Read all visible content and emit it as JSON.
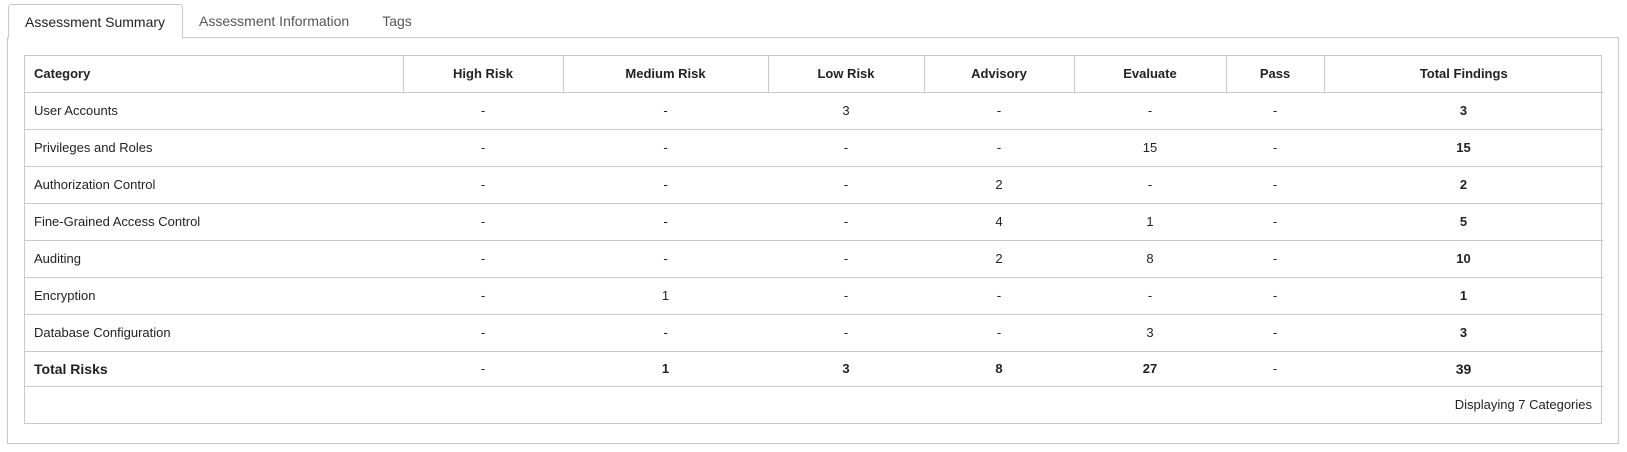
{
  "tabs": [
    {
      "label": "Assessment Summary",
      "active": true
    },
    {
      "label": "Assessment Information",
      "active": false
    },
    {
      "label": "Tags",
      "active": false
    }
  ],
  "table": {
    "headers": [
      "Category",
      "High Risk",
      "Medium Risk",
      "Low Risk",
      "Advisory",
      "Evaluate",
      "Pass",
      "Total Findings"
    ],
    "rows": [
      {
        "category": "User Accounts",
        "high": "-",
        "medium": "-",
        "low": "3",
        "advisory": "-",
        "evaluate": "-",
        "pass": "-",
        "total": "3"
      },
      {
        "category": "Privileges and Roles",
        "high": "-",
        "medium": "-",
        "low": "-",
        "advisory": "-",
        "evaluate": "15",
        "pass": "-",
        "total": "15"
      },
      {
        "category": "Authorization Control",
        "high": "-",
        "medium": "-",
        "low": "-",
        "advisory": "2",
        "evaluate": "-",
        "pass": "-",
        "total": "2"
      },
      {
        "category": "Fine-Grained Access Control",
        "high": "-",
        "medium": "-",
        "low": "-",
        "advisory": "4",
        "evaluate": "1",
        "pass": "-",
        "total": "5"
      },
      {
        "category": "Auditing",
        "high": "-",
        "medium": "-",
        "low": "-",
        "advisory": "2",
        "evaluate": "8",
        "pass": "-",
        "total": "10"
      },
      {
        "category": "Encryption",
        "high": "-",
        "medium": "1",
        "low": "-",
        "advisory": "-",
        "evaluate": "-",
        "pass": "-",
        "total": "1"
      },
      {
        "category": "Database Configuration",
        "high": "-",
        "medium": "-",
        "low": "-",
        "advisory": "-",
        "evaluate": "3",
        "pass": "-",
        "total": "3"
      }
    ],
    "totals": {
      "category": "Total Risks",
      "high": "-",
      "medium": "1",
      "low": "3",
      "advisory": "8",
      "evaluate": "27",
      "pass": "-",
      "total": "39"
    },
    "footer": "Displaying 7 Categories"
  },
  "colors": {
    "border": "#c9c9c9",
    "text": "#222222",
    "inactive_tab_text": "#555555"
  }
}
